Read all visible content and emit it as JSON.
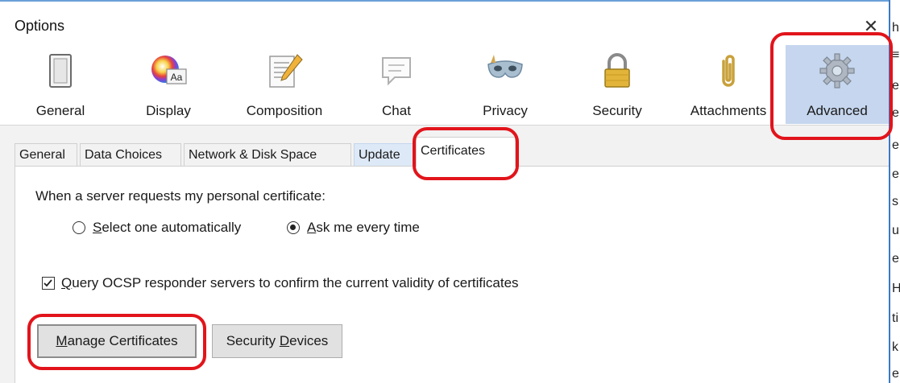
{
  "window": {
    "title": "Options",
    "close_glyph": "✕"
  },
  "toolbar": {
    "panes": [
      {
        "label": "General",
        "icon": "switch-icon"
      },
      {
        "label": "Display",
        "icon": "color-palette-icon",
        "icon_text": "Aa"
      },
      {
        "label": "Composition",
        "icon": "document-pencil-icon"
      },
      {
        "label": "Chat",
        "icon": "speech-bubble-icon"
      },
      {
        "label": "Privacy",
        "icon": "mask-icon"
      },
      {
        "label": "Security",
        "icon": "padlock-icon"
      },
      {
        "label": "Attachments",
        "icon": "paperclip-icon"
      },
      {
        "label": "Advanced",
        "icon": "gear-icon",
        "selected": true
      }
    ]
  },
  "tabs": [
    {
      "label": "General"
    },
    {
      "label": "Data Choices"
    },
    {
      "label": "Network & Disk Space"
    },
    {
      "label": "Update"
    },
    {
      "label": "Certificates",
      "active": true
    }
  ],
  "certificates": {
    "request_prompt": "When a server requests my personal certificate:",
    "radio_auto": {
      "mnemonic": "S",
      "rest": "elect one automatically",
      "checked": false
    },
    "radio_ask": {
      "mnemonic": "A",
      "rest": "sk me every time",
      "checked": true
    },
    "ocsp": {
      "mnemonic": "Q",
      "rest": "uery OCSP responder servers to confirm the current validity of certificates",
      "checked": true
    },
    "manage_button": {
      "mnemonic": "M",
      "rest": "anage Certificates"
    },
    "devices_button": {
      "prefix": "Security ",
      "mnemonic": "D",
      "rest": "evices"
    }
  },
  "background_window_edge": [
    "h",
    "≡",
    "e",
    "e",
    "e",
    "e",
    "s",
    "u",
    "e",
    "H",
    "ti",
    "k",
    "e"
  ],
  "colors": {
    "selected_pane": "#c5d6ee",
    "annotation": "#e2141b",
    "accent": "#3c78c4"
  }
}
